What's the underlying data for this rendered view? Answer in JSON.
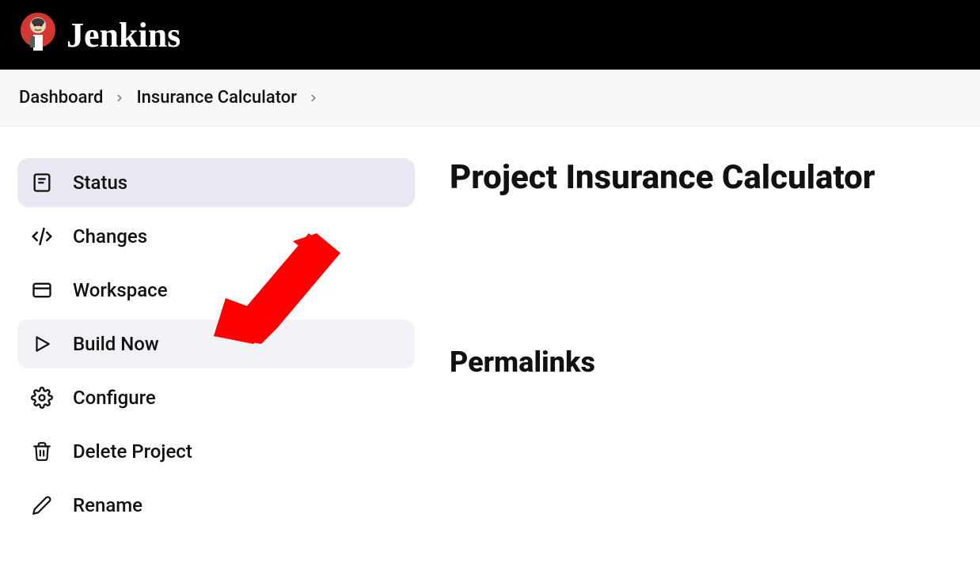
{
  "brand": "Jenkins",
  "breadcrumb": {
    "items": [
      "Dashboard",
      "Insurance Calculator"
    ]
  },
  "sidebar": {
    "items": [
      {
        "label": "Status"
      },
      {
        "label": "Changes"
      },
      {
        "label": "Workspace"
      },
      {
        "label": "Build Now"
      },
      {
        "label": "Configure"
      },
      {
        "label": "Delete Project"
      },
      {
        "label": "Rename"
      }
    ]
  },
  "main": {
    "title": "Project Insurance Calculator",
    "permalinks_heading": "Permalinks"
  }
}
